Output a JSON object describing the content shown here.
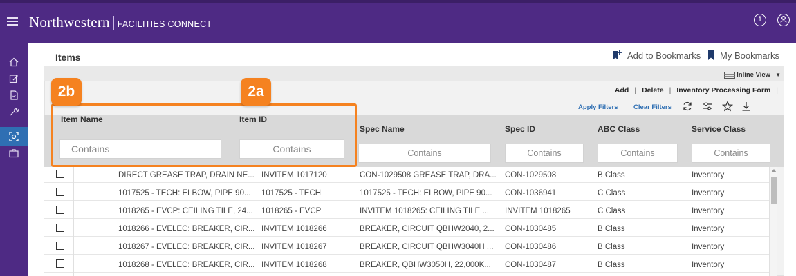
{
  "header": {
    "brand_main": "Northwestern",
    "brand_sub": "FACILITIES CONNECT"
  },
  "page": {
    "title": "Items"
  },
  "bookmarks": {
    "add_label": "Add to Bookmarks",
    "my_label": "My Bookmarks"
  },
  "toolbar": {
    "view_label": "Inline View",
    "add_label": "Add",
    "delete_label": "Delete",
    "form_label": "Inventory Processing Form",
    "apply_filters": "Apply Filters",
    "clear_filters": "Clear Filters"
  },
  "callouts": {
    "b": "2b",
    "a": "2a"
  },
  "columns": [
    {
      "label": "Item Name",
      "placeholder": "Contains"
    },
    {
      "label": "Item ID",
      "placeholder": "Contains"
    },
    {
      "label": "Spec Name",
      "placeholder": "Contains"
    },
    {
      "label": "Spec ID",
      "placeholder": "Contains"
    },
    {
      "label": "ABC Class",
      "placeholder": "Contains"
    },
    {
      "label": "Service Class",
      "placeholder": "Contains"
    }
  ],
  "rows": [
    [
      "DIRECT GREASE TRAP, DRAIN NE...",
      "INVITEM 1017120",
      "CON-1029508 GREASE TRAP, DRA...",
      "CON-1029508",
      "B Class",
      "Inventory"
    ],
    [
      "1017525 - TECH: ELBOW, PIPE 90...",
      "1017525 - TECH",
      "1017525 - TECH: ELBOW, PIPE 90...",
      "CON-1036941",
      "C Class",
      "Inventory"
    ],
    [
      "1018265 - EVCP: CEILING TILE, 24...",
      "1018265 - EVCP",
      "INVITEM 1018265: CEILING TILE ...",
      "INVITEM 1018265",
      "C Class",
      "Inventory"
    ],
    [
      "1018266 - EVELEC: BREAKER, CIR...",
      "INVITEM 1018266",
      "BREAKER, CIRCUIT QBHW2040, 2...",
      "CON-1030485",
      "B Class",
      "Inventory"
    ],
    [
      "1018267 - EVELEC: BREAKER, CIR...",
      "INVITEM 1018267",
      "BREAKER, CIRCUIT QBHW3040H ...",
      "CON-1030486",
      "B Class",
      "Inventory"
    ],
    [
      "1018268 - EVELEC: BREAKER, CIR...",
      "INVITEM 1018268",
      "BREAKER, QBHW3050H, 22,000K...",
      "CON-1030487",
      "B Class",
      "Inventory"
    ]
  ],
  "colors": {
    "brand_purple": "#4e2a84",
    "callout_orange": "#f58220",
    "link_blue": "#2f6fb3"
  }
}
